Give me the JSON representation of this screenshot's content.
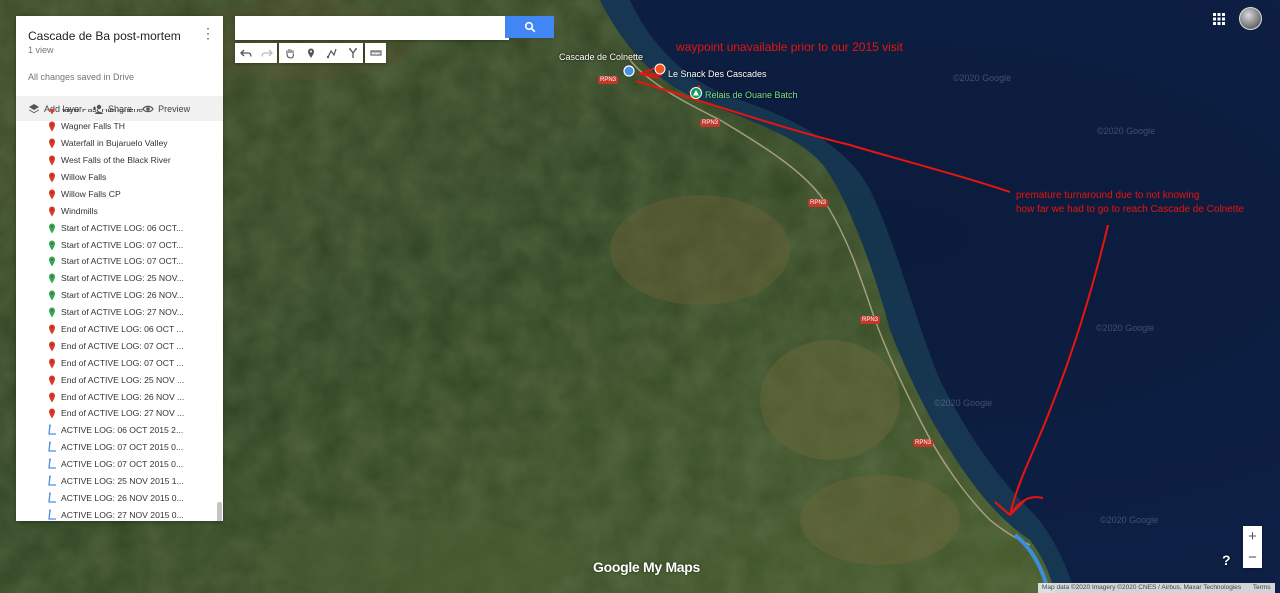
{
  "panel": {
    "title": "Cascade de Ba post-mortem",
    "views": "1 view",
    "saved": "All changes saved in Drive",
    "actions": {
      "add_layer": "Add layer",
      "share": "Share",
      "preview": "Preview"
    },
    "items": [
      {
        "label": "View Past Hienghene",
        "type": "red"
      },
      {
        "label": "Wagner Falls TH",
        "type": "red"
      },
      {
        "label": "Waterfall in Bujaruelo Valley",
        "type": "red"
      },
      {
        "label": "West Falls of the Black River",
        "type": "red"
      },
      {
        "label": "Willow Falls",
        "type": "red"
      },
      {
        "label": "Willow Falls CP",
        "type": "red"
      },
      {
        "label": "Windmills",
        "type": "red"
      },
      {
        "label": "Start of ACTIVE LOG: 06 OCT...",
        "type": "green"
      },
      {
        "label": "Start of ACTIVE LOG: 07 OCT...",
        "type": "green"
      },
      {
        "label": "Start of ACTIVE LOG: 07 OCT...",
        "type": "green"
      },
      {
        "label": "Start of ACTIVE LOG: 25 NOV...",
        "type": "green"
      },
      {
        "label": "Start of ACTIVE LOG: 26 NOV...",
        "type": "green"
      },
      {
        "label": "Start of ACTIVE LOG: 27 NOV...",
        "type": "green"
      },
      {
        "label": "End of ACTIVE LOG: 06 OCT ...",
        "type": "red"
      },
      {
        "label": "End of ACTIVE LOG: 07 OCT ...",
        "type": "red"
      },
      {
        "label": "End of ACTIVE LOG: 07 OCT ...",
        "type": "red"
      },
      {
        "label": "End of ACTIVE LOG: 25 NOV ...",
        "type": "red"
      },
      {
        "label": "End of ACTIVE LOG: 26 NOV ...",
        "type": "red"
      },
      {
        "label": "End of ACTIVE LOG: 27 NOV ...",
        "type": "red"
      },
      {
        "label": "ACTIVE LOG: 06 OCT 2015 2...",
        "type": "line"
      },
      {
        "label": "ACTIVE LOG: 07 OCT 2015 0...",
        "type": "line"
      },
      {
        "label": "ACTIVE LOG: 07 OCT 2015 0...",
        "type": "line"
      },
      {
        "label": "ACTIVE LOG: 25 NOV 2015 1...",
        "type": "line"
      },
      {
        "label": "ACTIVE LOG: 26 NOV 2015 0...",
        "type": "line"
      },
      {
        "label": "ACTIVE LOG: 27 NOV 2015 0...",
        "type": "line"
      }
    ]
  },
  "search": {
    "value": "",
    "placeholder": ""
  },
  "map": {
    "place_cascade": "Cascade de Colnette",
    "place_snack": "Le Snack Des Cascades",
    "place_relais": "Relais de Ouane Batch",
    "road_label": "RPN3",
    "watermark": "©2020 Google",
    "annotation_top": "waypoint unavailable prior to our 2015 visit",
    "annotation_mid_1": "premature turnaround due to not knowing",
    "annotation_mid_2": "how far we had to go to reach Cascade de Colnette",
    "logo": "Google My Maps",
    "attribution": "Map data ©2020 Imagery ©2020 CNES / Airbus, Maxar Technologies",
    "terms": "Terms",
    "zoom_in": "+",
    "zoom_out": "−",
    "help": "?"
  },
  "colors": {
    "annotation": "#e8140f",
    "accent": "#4285f4",
    "green_pin": "#34a853",
    "red_pin": "#d93b2b"
  }
}
